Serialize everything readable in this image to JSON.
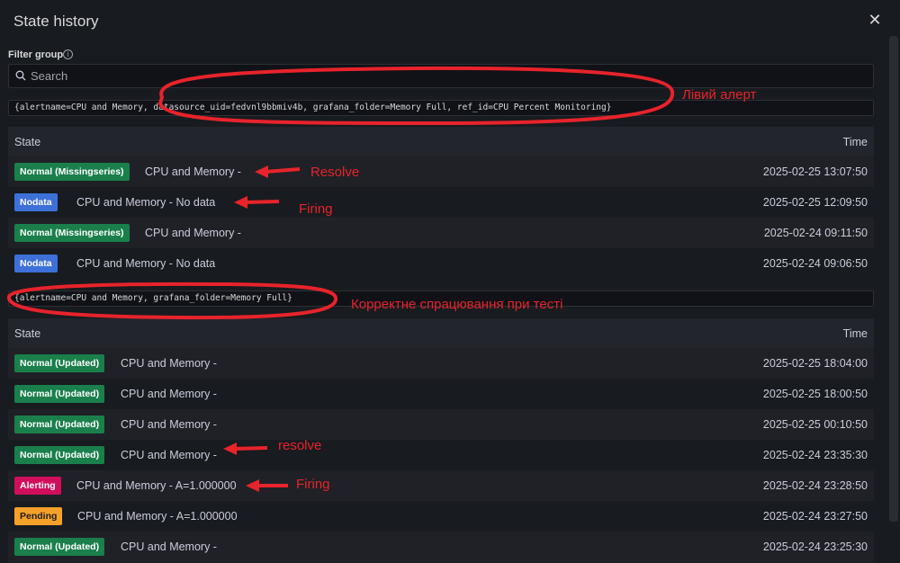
{
  "modal": {
    "title": "State history"
  },
  "filter": {
    "label": "Filter group",
    "search_placeholder": "Search"
  },
  "groups": [
    {
      "label": "{alertname=CPU and Memory, datasource_uid=fedvnl9bbmiv4b, grafana_folder=Memory Full, ref_id=CPU Percent Monitoring}",
      "header": {
        "state": "State",
        "time": "Time"
      },
      "rows": [
        {
          "state": "Normal (Missingseries)",
          "kind": "normal",
          "desc": "CPU and Memory -",
          "time": "2025-02-25 13:07:50"
        },
        {
          "state": "Nodata",
          "kind": "nodata",
          "desc": "CPU and Memory - No data",
          "time": "2025-02-25 12:09:50"
        },
        {
          "state": "Normal (Missingseries)",
          "kind": "normal",
          "desc": "CPU and Memory -",
          "time": "2025-02-24 09:11:50"
        },
        {
          "state": "Nodata",
          "kind": "nodata",
          "desc": "CPU and Memory - No data",
          "time": "2025-02-24 09:06:50"
        }
      ]
    },
    {
      "label": "{alertname=CPU and Memory, grafana_folder=Memory Full}",
      "header": {
        "state": "State",
        "time": "Time"
      },
      "rows": [
        {
          "state": "Normal (Updated)",
          "kind": "normal",
          "desc": "CPU and Memory -",
          "time": "2025-02-25 18:04:00"
        },
        {
          "state": "Normal (Updated)",
          "kind": "normal",
          "desc": "CPU and Memory -",
          "time": "2025-02-25 18:00:50"
        },
        {
          "state": "Normal (Updated)",
          "kind": "normal",
          "desc": "CPU and Memory -",
          "time": "2025-02-25 00:10:50"
        },
        {
          "state": "Normal (Updated)",
          "kind": "normal",
          "desc": "CPU and Memory -",
          "time": "2025-02-24 23:35:30"
        },
        {
          "state": "Alerting",
          "kind": "alerting",
          "desc": "CPU and Memory - A=1.000000",
          "time": "2025-02-24 23:28:50"
        },
        {
          "state": "Pending",
          "kind": "pending",
          "desc": "CPU and Memory - A=1.000000",
          "time": "2025-02-24 23:27:50"
        },
        {
          "state": "Normal (Updated)",
          "kind": "normal",
          "desc": "CPU and Memory -",
          "time": "2025-02-24 23:25:30"
        }
      ]
    }
  ],
  "annotations": {
    "left_alert": "Лівий алерт",
    "resolve_1": "Resolve",
    "firing_1": "Firing",
    "correct": "Корректне спрацювання при тесті",
    "resolve_2": "resolve",
    "firing_2": "Firing",
    "color": "#e8232b"
  },
  "icons": {
    "close": "close-icon",
    "info": "info-icon",
    "search": "search-icon"
  }
}
